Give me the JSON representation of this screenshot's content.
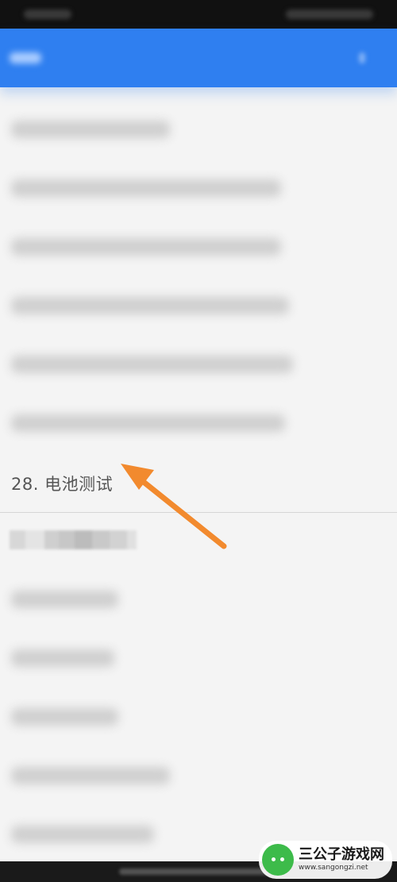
{
  "list": {
    "focus_item": "28. 电池测试"
  },
  "watermark": {
    "brand": "三公子游戏网",
    "domain": "www.sangongzi.net",
    "logo_icon": "android-robot-icon"
  },
  "colors": {
    "app_bar": "#2f7ff0",
    "annotation_arrow": "#f28a2e",
    "background": "#f4f4f4"
  }
}
